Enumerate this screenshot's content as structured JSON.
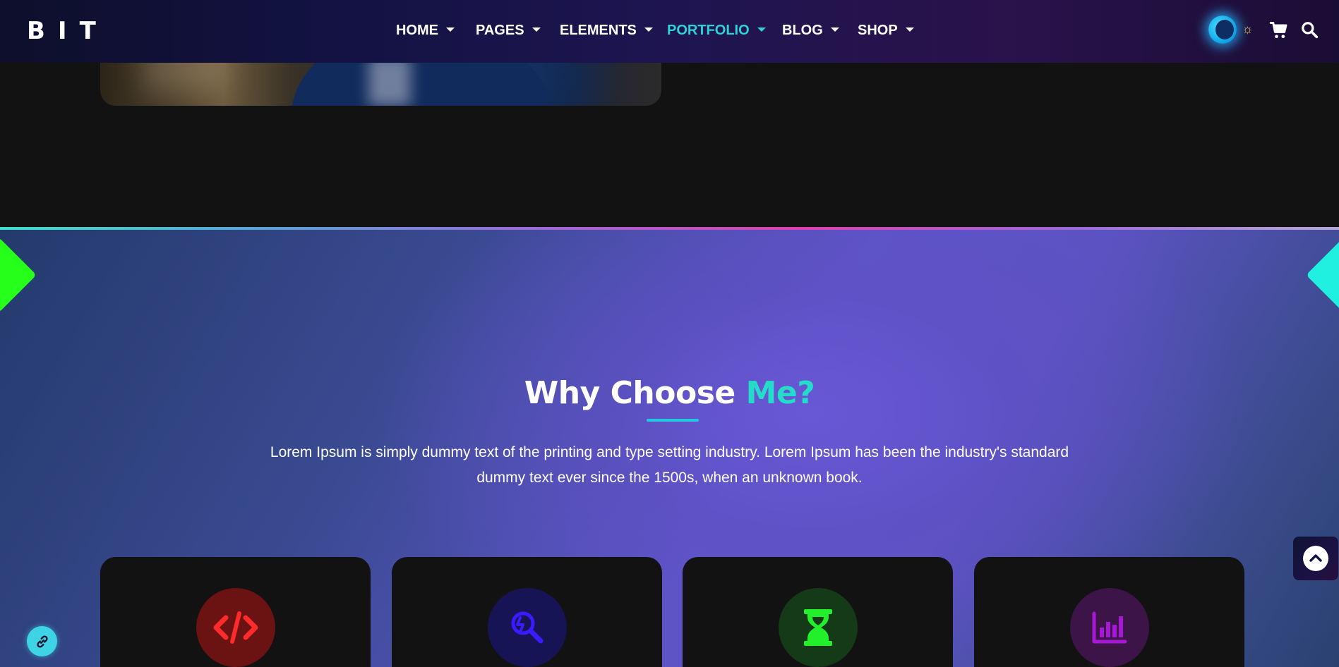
{
  "header": {
    "logo": "BIT",
    "nav": [
      {
        "label": "HOME",
        "active": false
      },
      {
        "label": "PAGES",
        "active": false
      },
      {
        "label": "ELEMENTS",
        "active": false
      },
      {
        "label": "PORTFOLIO",
        "active": true
      },
      {
        "label": "BLOG",
        "active": false
      },
      {
        "label": "SHOP",
        "active": false
      }
    ],
    "icons": [
      "theme-toggle",
      "sun-icon",
      "cart-icon",
      "search-icon"
    ],
    "accent_color": "#2fd3d6"
  },
  "section": {
    "title_main": "Why Choose",
    "title_accent": "Me?",
    "description": "Lorem Ipsum is simply dummy text of the printing and type setting industry. Lorem Ipsum has been the industry's standard dummy text ever since the 1500s, when an unknown book.",
    "cards": [
      {
        "icon": "code-icon",
        "icon_color": "#ff2a2a",
        "circle_color": "#6b1212"
      },
      {
        "icon": "search-analytics-icon",
        "icon_color": "#3a1bff",
        "circle_color": "#161454"
      },
      {
        "icon": "hourglass-icon",
        "icon_color": "#22f02a",
        "circle_color": "#143a17"
      },
      {
        "icon": "bar-chart-icon",
        "icon_color": "#a617d6",
        "circle_color": "#3d1448"
      }
    ]
  },
  "decorations": {
    "diamond_left_color": "#25ff1a",
    "diamond_right_color": "#1ff0e0"
  },
  "floating": {
    "scroll_top_icon": "chevron-up-icon",
    "link_icon": "link-icon"
  }
}
